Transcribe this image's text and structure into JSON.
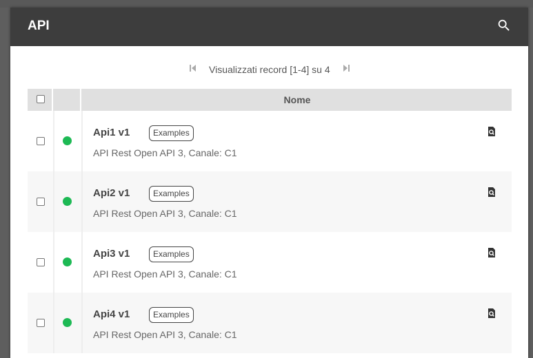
{
  "header": {
    "title": "API",
    "search_icon": "search-icon"
  },
  "pager": {
    "text": "Visualizzati record [1-4] su 4",
    "first_icon": "first-page-icon",
    "last_icon": "last-page-icon"
  },
  "table": {
    "columns": {
      "name_header": "Nome"
    },
    "rows": [
      {
        "name": "Api1 v1",
        "tag": "Examples",
        "description": "API Rest Open API 3, Canale: C1",
        "status_color": "#1db954"
      },
      {
        "name": "Api2 v1",
        "tag": "Examples",
        "description": "API Rest Open API 3, Canale: C1",
        "status_color": "#1db954"
      },
      {
        "name": "Api3 v1",
        "tag": "Examples",
        "description": "API Rest Open API 3, Canale: C1",
        "status_color": "#1db954"
      },
      {
        "name": "Api4 v1",
        "tag": "Examples",
        "description": "API Rest Open API 3, Canale: C1",
        "status_color": "#1db954"
      }
    ],
    "detail_icon": "view-details-icon"
  },
  "colors": {
    "header_bg": "#3d3d3d",
    "table_header_bg": "#e0e0e0",
    "status_active": "#1db954"
  }
}
